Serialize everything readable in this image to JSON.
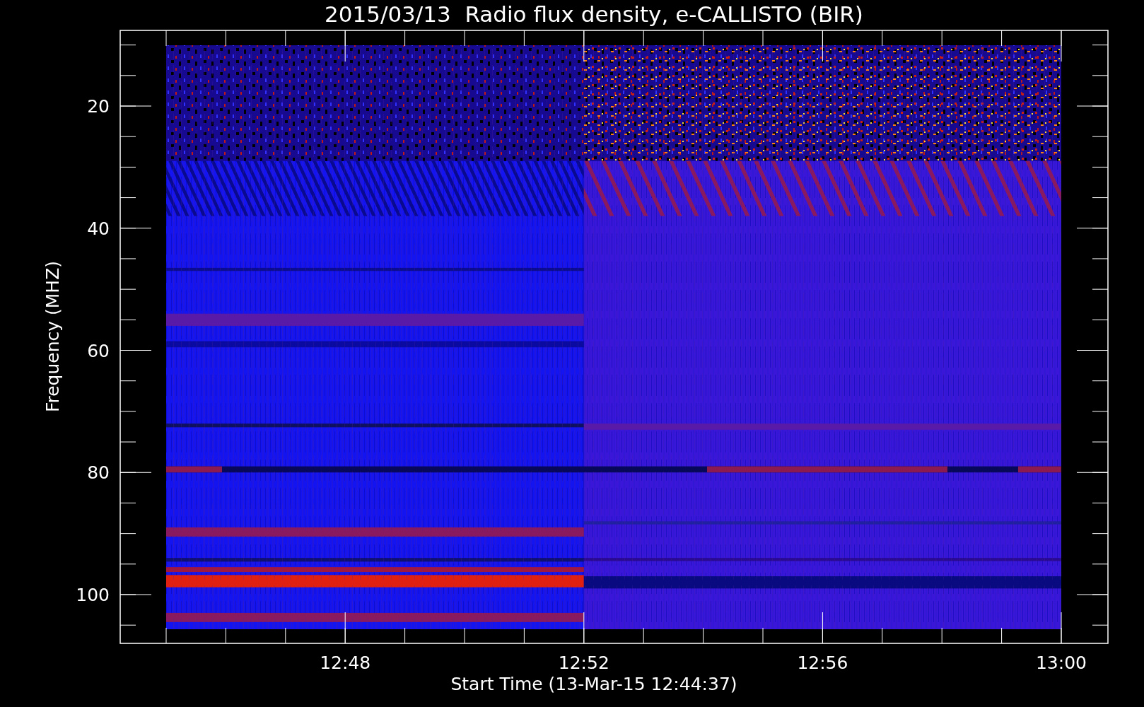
{
  "title": "2015/03/13  Radio flux density, e-CALLISTO (BIR)",
  "plot": {
    "ylabel": "Frequency (MHZ)",
    "xlabel": "Start Time (13-Mar-15 12:44:37)",
    "yticks": [
      "20",
      "40",
      "60",
      "80",
      "100"
    ],
    "xticks": [
      "12:48",
      "12:52",
      "12:56",
      "13:00"
    ]
  }
}
